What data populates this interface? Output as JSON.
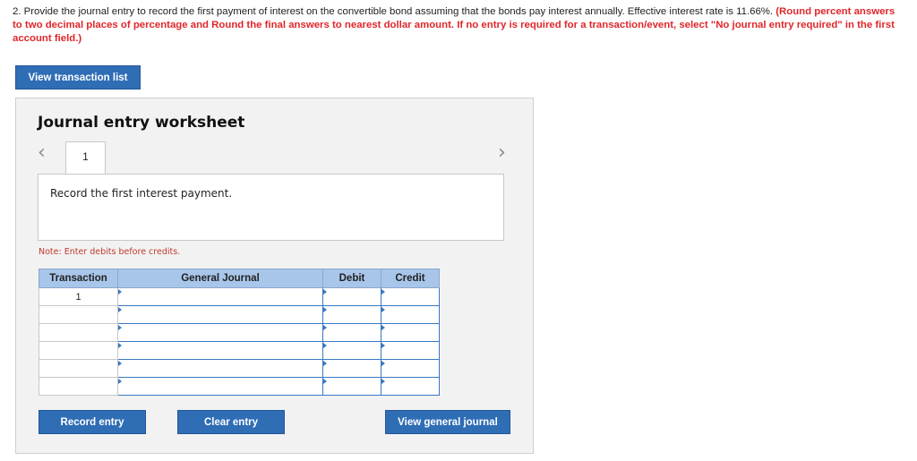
{
  "question": {
    "text": "2. Provide the journal entry to record the first payment of interest on the convertible bond assuming that the bonds pay interest annually. Effective interest rate is 11.66%. ",
    "instruction": "(Round percent answers to two decimal places of percentage and Round the final answers to nearest dollar amount. If no entry is required for a transaction/event, select \"No journal entry required\" in the first account field.)"
  },
  "buttons": {
    "view_transaction_list": "View transaction list",
    "record_entry": "Record entry",
    "clear_entry": "Clear entry",
    "view_general_journal": "View general journal"
  },
  "worksheet": {
    "title": "Journal entry worksheet",
    "nav_prev": "<",
    "nav_next": ">",
    "active_tab": "1",
    "description": "Record the first interest payment.",
    "note": "Note: Enter debits before credits."
  },
  "table": {
    "headers": [
      "Transaction",
      "General Journal",
      "Debit",
      "Credit"
    ],
    "rows": [
      {
        "transaction": "1",
        "account": "",
        "debit": "",
        "credit": ""
      },
      {
        "transaction": "",
        "account": "",
        "debit": "",
        "credit": ""
      },
      {
        "transaction": "",
        "account": "",
        "debit": "",
        "credit": ""
      },
      {
        "transaction": "",
        "account": "",
        "debit": "",
        "credit": ""
      },
      {
        "transaction": "",
        "account": "",
        "debit": "",
        "credit": ""
      },
      {
        "transaction": "",
        "account": "",
        "debit": "",
        "credit": ""
      }
    ]
  },
  "colors": {
    "button_blue": "#2f6db5",
    "header_blue": "#a8c6ea",
    "instruction_red": "#e0262a",
    "input_border": "#3a78c2"
  }
}
